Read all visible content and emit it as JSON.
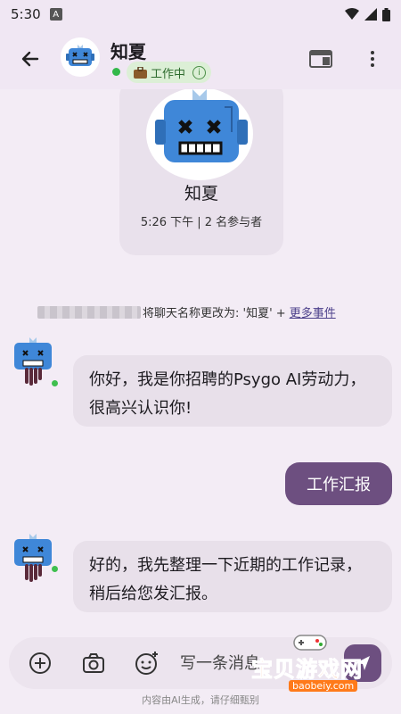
{
  "status_bar": {
    "time": "5:30",
    "badge": "A"
  },
  "header": {
    "title": "知夏",
    "status": "工作中",
    "status_icon": "briefcase-icon",
    "info_icon": "i",
    "colors": {
      "online": "#33b84a",
      "chip_bg": "#dcefd6"
    }
  },
  "chat_card": {
    "name": "知夏",
    "meta": "5:26 下午 | 2 名参与者"
  },
  "event": {
    "text": "将聊天名称更改为: '知夏' + ",
    "link": "更多事件"
  },
  "messages": [
    {
      "from": "bot",
      "text": "你好，我是你招聘的Psygo AI劳动力，很高兴认识你!"
    },
    {
      "from": "user",
      "text": "工作汇报"
    },
    {
      "from": "bot",
      "text": "好的，我先整理一下近期的工作记录，稍后给您发汇报。"
    }
  ],
  "composer": {
    "placeholder": "写一条消息"
  },
  "footer": "内容由AI生成，请仔细甄别",
  "watermark": {
    "text": "宝贝游戏网",
    "url": "baobeiy.com"
  },
  "colors": {
    "accent": "#6d4f80",
    "background": "#f3ecf5",
    "bubble_in": "#e8e0ea"
  }
}
